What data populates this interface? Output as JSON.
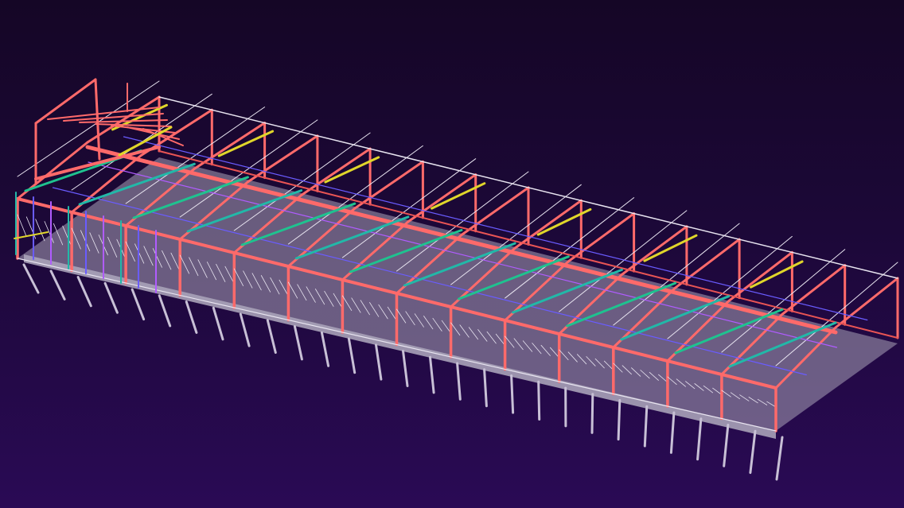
{
  "viewport": {
    "background_top": "#150626",
    "background_bottom": "#2a0a55"
  },
  "model": {
    "frame_colors": {
      "frame": "#ff6a6a",
      "frame_dark": "#e85454",
      "purlin_yellow": "#e0d62a",
      "brace_green": "#1fc28f",
      "brace_teal": "#22b8a8",
      "secondary_blue": "#6a5cff",
      "secondary_violet": "#b05cff",
      "column_gray": "#c8c0d6",
      "slab_gray": "#a9a2b8",
      "edge_white": "#e8e4f0"
    },
    "bay_count": 14
  }
}
